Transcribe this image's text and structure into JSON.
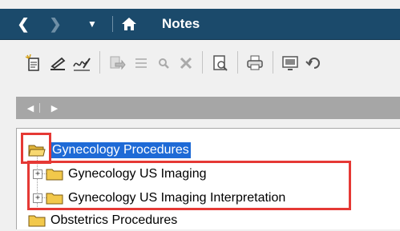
{
  "window": {
    "title": "Notes"
  },
  "navigation": {
    "back_icon": "chevron-left-icon",
    "forward_icon": "chevron-right-icon",
    "menu_icon": "caret-down-icon",
    "home_icon": "home-icon"
  },
  "toolbar": {
    "icons": [
      "new-note-icon",
      "sign-icon",
      "signature-icon",
      "forward-icon",
      "list-icon",
      "search-icon",
      "delete-icon",
      "document-preview-icon",
      "print-icon",
      "display-icon",
      "refresh-icon"
    ]
  },
  "pager": {
    "prev_icon": "triangle-left-icon",
    "next_icon": "triangle-right-icon"
  },
  "tree": {
    "items": [
      {
        "label": "Gynecology Procedures",
        "selected": true,
        "expanded": true,
        "level": 0
      },
      {
        "label": "Gynecology US Imaging",
        "selected": false,
        "expanded": false,
        "level": 1
      },
      {
        "label": "Gynecology US Imaging Interpretation",
        "selected": false,
        "expanded": false,
        "level": 1
      },
      {
        "label": "Obstetrics Procedures",
        "selected": false,
        "expanded": false,
        "level": 0
      }
    ]
  },
  "colors": {
    "titlebar": "#1b4a6b",
    "selection": "#1e6ad6",
    "annotation": "#e53935",
    "folder": "#f2c84b"
  }
}
